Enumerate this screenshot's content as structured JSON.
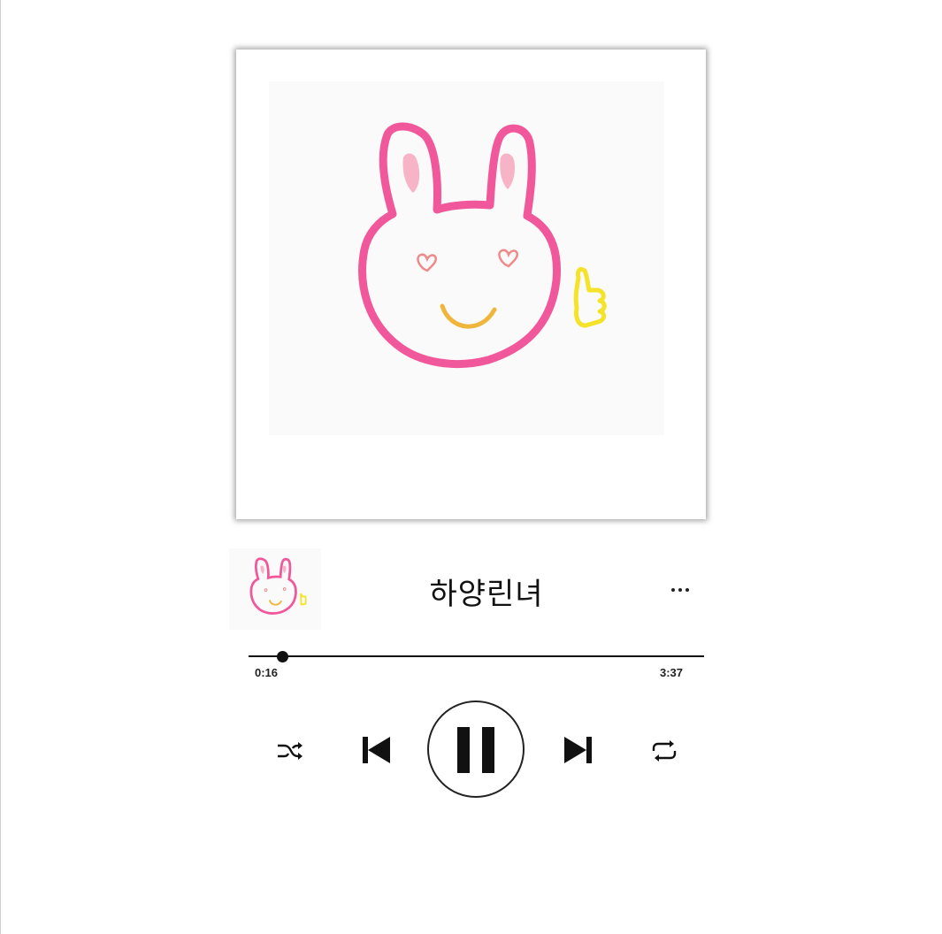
{
  "track": {
    "title": "하양린녀"
  },
  "progress": {
    "elapsed": "0:16",
    "total": "3:37",
    "fraction": 0.074
  },
  "icons": {
    "more": "more-horizontal-icon",
    "shuffle": "shuffle-icon",
    "previous": "skip-previous-icon",
    "pause": "pause-icon",
    "next": "skip-next-icon",
    "repeat": "repeat-icon"
  },
  "colors": {
    "bunny_outline": "#f0589b",
    "bunny_ear_inner": "#f7b4c6",
    "heart_eyes": "#f08a8a",
    "smile": "#f0b63c",
    "thumbs_up": "#f5e32a",
    "control": "#111111"
  }
}
